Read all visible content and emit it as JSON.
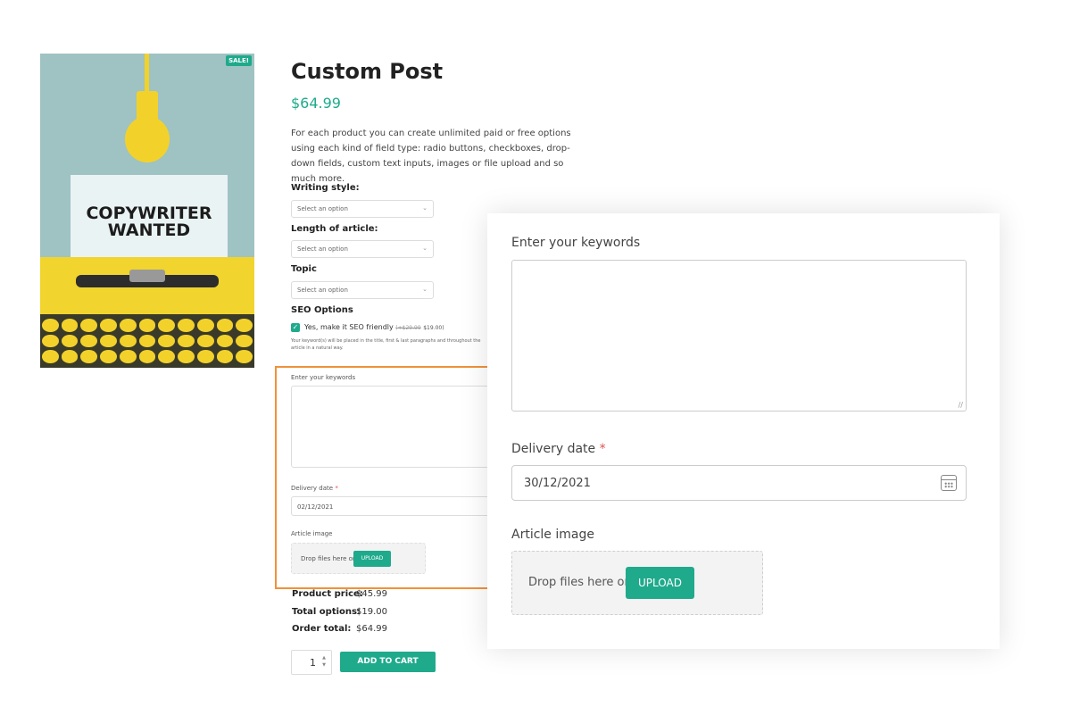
{
  "product": {
    "badge": "SALE!",
    "image_text_line1": "COPYWRITER",
    "image_text_line2": "WANTED",
    "title": "Custom Post",
    "price": "$64.99",
    "description": "For each product you can create unlimited paid or free options using each kind of field type: radio buttons, checkboxes, drop-down fields, custom text inputs, images or file upload and so much more."
  },
  "options": {
    "writing_style": {
      "label": "Writing style:",
      "placeholder": "Select an option"
    },
    "length": {
      "label": "Length of article:",
      "placeholder": "Select an option"
    },
    "topic": {
      "label": "Topic",
      "placeholder": "Select an option"
    },
    "seo": {
      "label": "SEO Options",
      "checkbox_label": "Yes, make it SEO friendly",
      "old_price": "(+$29.99",
      "new_price": "$19.00)",
      "note": "Your keyword(s) will be placed in the title, first & last paragraphs and throughout the article in a natural way."
    }
  },
  "mini_form": {
    "keywords_label": "Enter your keywords",
    "date_label": "Delivery date",
    "required_mark": "*",
    "date_value": "02/12/2021",
    "image_label": "Article image",
    "drop_text": "Drop files here or",
    "upload_label": "UPLOAD"
  },
  "totals": {
    "product_price_label": "Product price:",
    "product_price": "$45.99",
    "total_options_label": "Total options:",
    "total_options": "$19.00",
    "order_total_label": "Order total:",
    "order_total": "$64.99"
  },
  "cart": {
    "quantity": "1",
    "add_label": "ADD TO CART"
  },
  "zoom_form": {
    "keywords_label": "Enter your keywords",
    "date_label": "Delivery date",
    "required_mark": "*",
    "date_value": "30/12/2021",
    "image_label": "Article image",
    "drop_text": "Drop files here or",
    "upload_label": "UPLOAD"
  },
  "colors": {
    "accent": "#1faa8c",
    "highlight": "#f0913a",
    "required": "#d9534f"
  }
}
